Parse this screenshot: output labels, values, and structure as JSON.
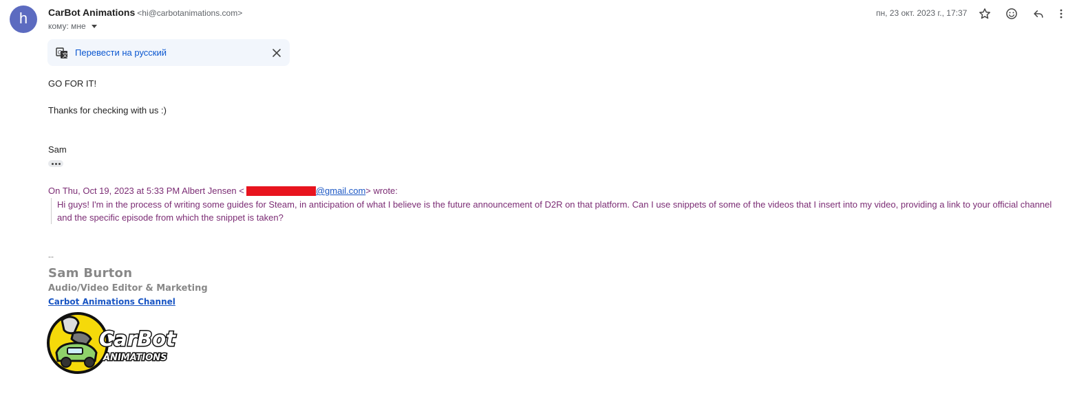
{
  "sender": {
    "avatar_letter": "h",
    "name": "CarBot Animations",
    "email": "<hi@carbotanimations.com>",
    "to_label": "кому: мне",
    "date": "пн, 23 окт. 2023 г., 17:37"
  },
  "actions": [
    "star-icon",
    "emoji-icon",
    "reply-icon",
    "more-vert-icon"
  ],
  "translate": {
    "link": "Перевести на русский"
  },
  "message": {
    "line1": "GO FOR IT!",
    "line2": "Thanks for checking with us :)",
    "sign": "Sam"
  },
  "quote": {
    "attr_prefix": "On Thu, Oct 19, 2023 at 5:33 PM Albert Jensen <",
    "email_visible": "@gmail.com",
    "attr_suffix": "> wrote:",
    "text": "Hi guys! I'm in the process of writing some guides for Steam, in anticipation of what I believe is the future announcement of D2R on that platform. Can I use snippets of some of the videos that I insert into my video, providing a link to your official channel and the specific episode from which the snippet is taken?"
  },
  "signature": {
    "dash": "--",
    "name": "Sam Burton",
    "title": "Audio/Video Editor & Marketing",
    "link": "Carbot Animations Channel",
    "logo_line1": "CarBot",
    "logo_line2": "ANIMATIONS"
  },
  "colors": {
    "avatar": "#5c6bc0",
    "quote": "#7b2c74",
    "link": "#1a56c4",
    "redaction": "#e8141e"
  }
}
